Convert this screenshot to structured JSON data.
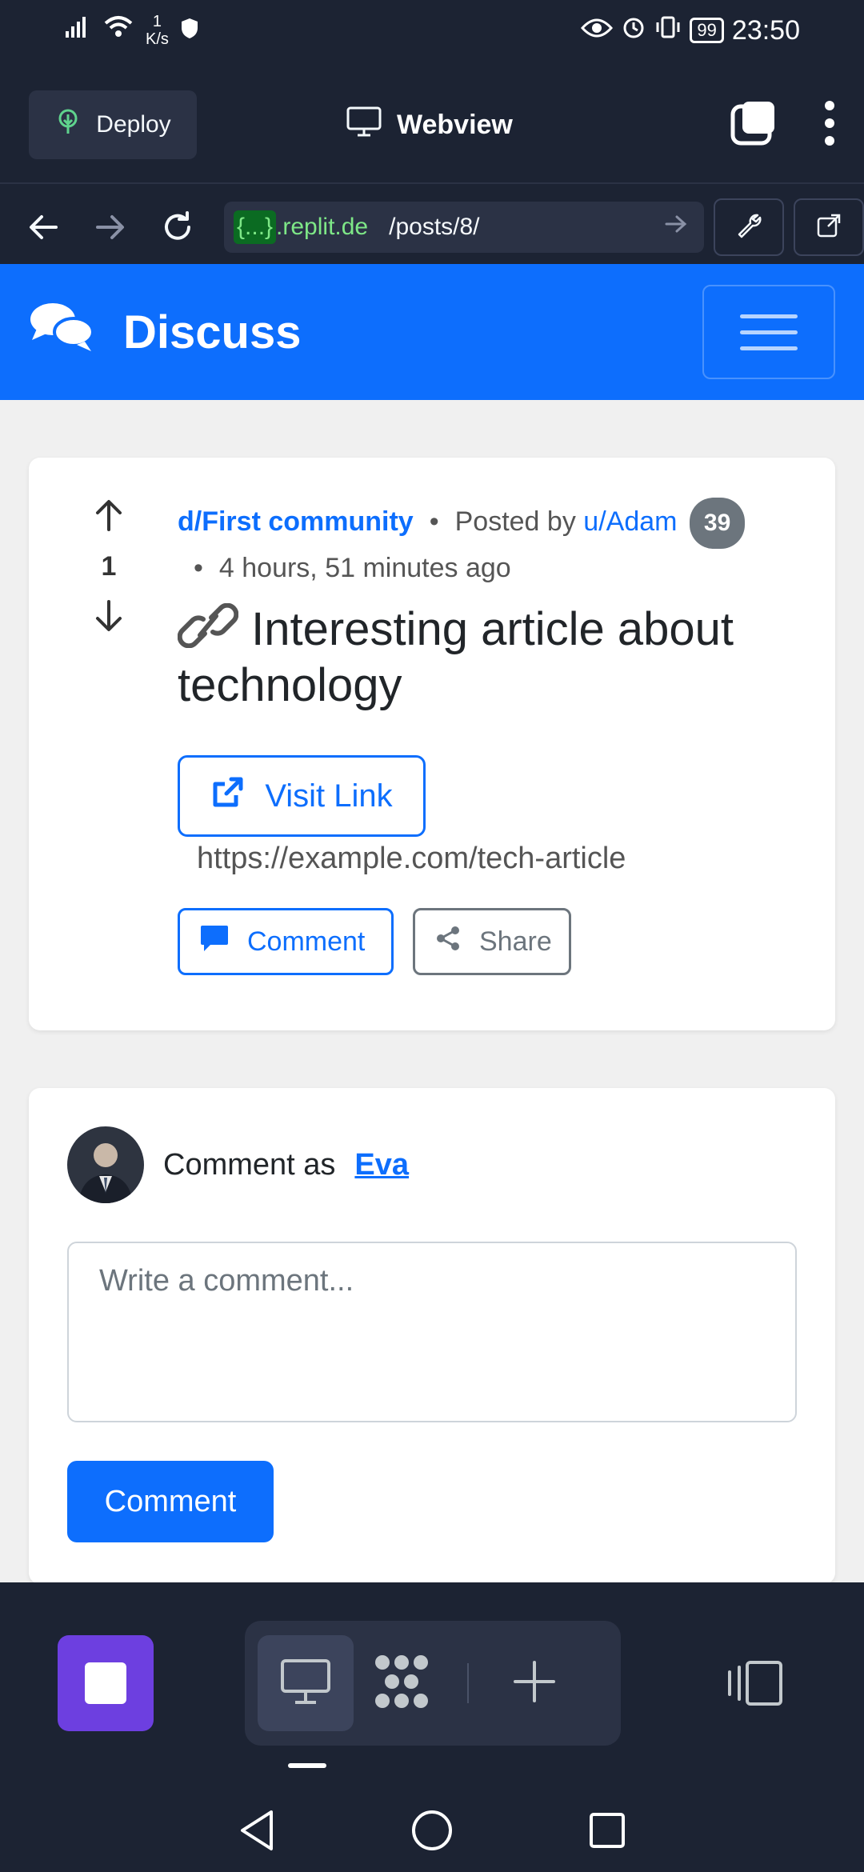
{
  "status_bar": {
    "net_speed_value": "1",
    "net_speed_unit": "K/s",
    "battery": "99",
    "time": "23:50"
  },
  "replit_toolbar": {
    "deploy_label": "Deploy",
    "title": "Webview",
    "url_badge": "{...}",
    "url_host": ".replit.de",
    "url_path": "/posts/8/"
  },
  "site": {
    "brand": "Discuss"
  },
  "post": {
    "vote_count": "1",
    "community": "d/First community",
    "posted_by_label": "Posted by",
    "author": "u/Adam",
    "badge_count": "39",
    "time_ago": "4 hours, 51 minutes ago",
    "title": "Interesting article about technology",
    "visit_link_label": "Visit Link",
    "link_url": "https://example.com/tech-article",
    "comment_label": "Comment",
    "share_label": "Share"
  },
  "comment_form": {
    "comment_as_label": "Comment as",
    "username": "Eva",
    "placeholder": "Write a comment...",
    "submit_label": "Comment"
  },
  "colors": {
    "primary": "#0d6efd",
    "replit_bg": "#1c2333",
    "stop_button": "#6d3fe0"
  }
}
